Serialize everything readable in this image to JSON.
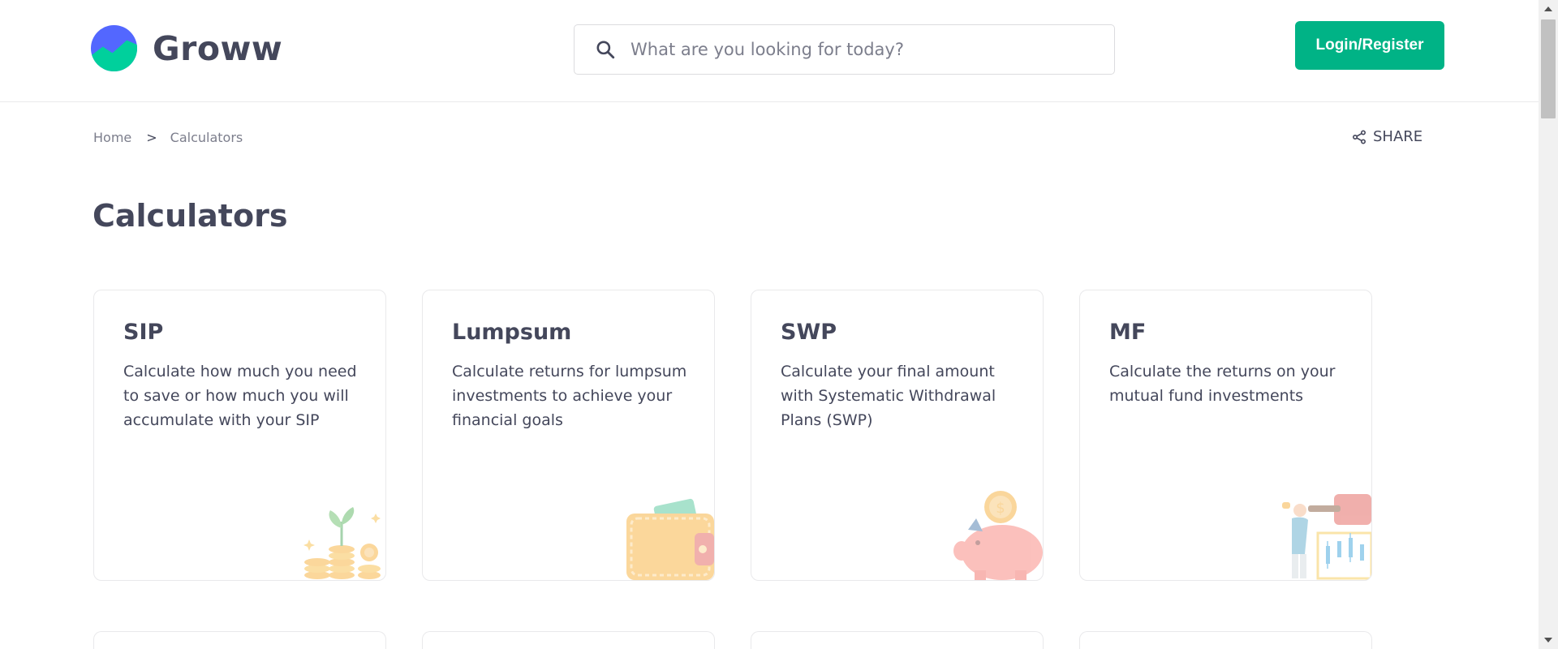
{
  "header": {
    "brand": "Groww",
    "search_placeholder": "What are you looking for today?",
    "login_label": "Login/Register"
  },
  "breadcrumb": {
    "home": "Home",
    "separator": ">",
    "current": "Calculators"
  },
  "share_label": "SHARE",
  "page_title": "Calculators",
  "cards": [
    {
      "title": "SIP",
      "description": "Calculate how much you need to save or how much you will accumulate with your SIP",
      "illustration": "coins-plant-icon"
    },
    {
      "title": "Lumpsum",
      "description": "Calculate returns for lumpsum investments to achieve your financial goals",
      "illustration": "wallet-icon"
    },
    {
      "title": "SWP",
      "description": "Calculate your final amount with Systematic Withdrawal Plans (SWP)",
      "illustration": "piggy-bank-icon"
    },
    {
      "title": "MF",
      "description": "Calculate the returns on your mutual fund investments",
      "illustration": "investor-chart-icon"
    }
  ],
  "colors": {
    "brand_green": "#00b386",
    "text_primary": "#44475b",
    "text_secondary": "#7c7e8c",
    "border": "#e9e9eb"
  }
}
